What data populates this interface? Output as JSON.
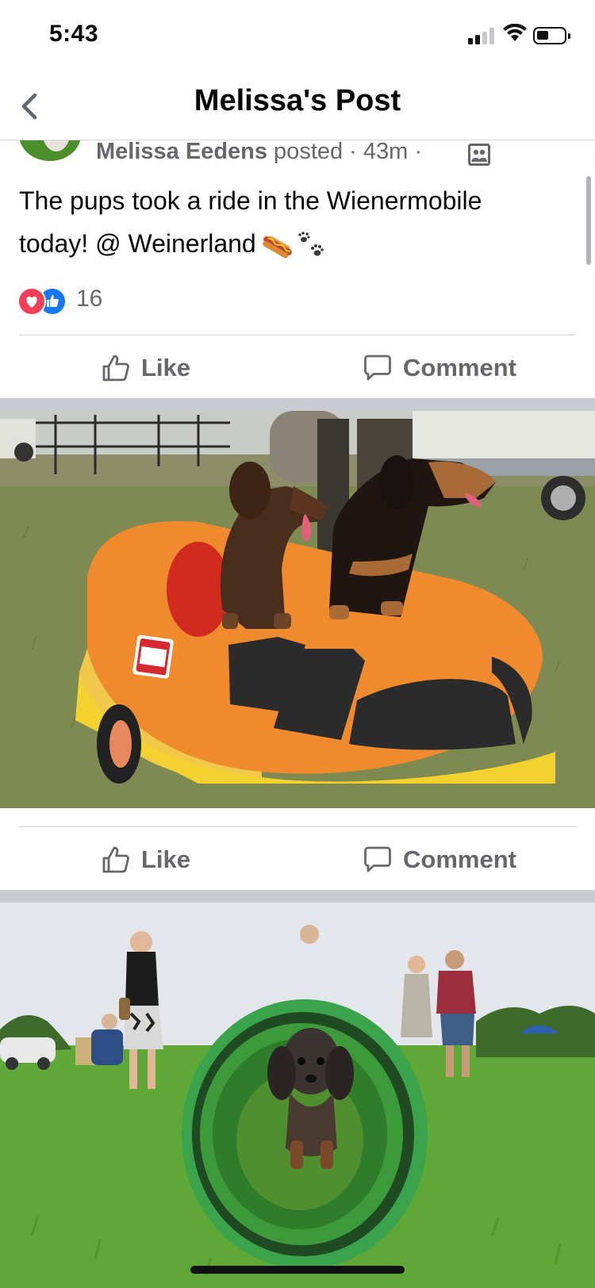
{
  "status_bar": {
    "time": "5:43"
  },
  "header": {
    "title": "Melissa's Post"
  },
  "post": {
    "author": "Melissa Eedens",
    "meta": " posted · 43m · ",
    "text_line1": "The pups took a ride in the Wienermobile",
    "text_line2": "today! @ Weinerland",
    "reaction_count": "16"
  },
  "actions": {
    "like_label": "Like",
    "comment_label": "Comment"
  },
  "photos": [
    {
      "description_icon": "wienermobile-photo"
    },
    {
      "description_icon": "tunnel-photo"
    }
  ],
  "colors": {
    "brand_blue": "#1877f2",
    "love_red": "#f33e58",
    "muted_text": "#65676b"
  }
}
